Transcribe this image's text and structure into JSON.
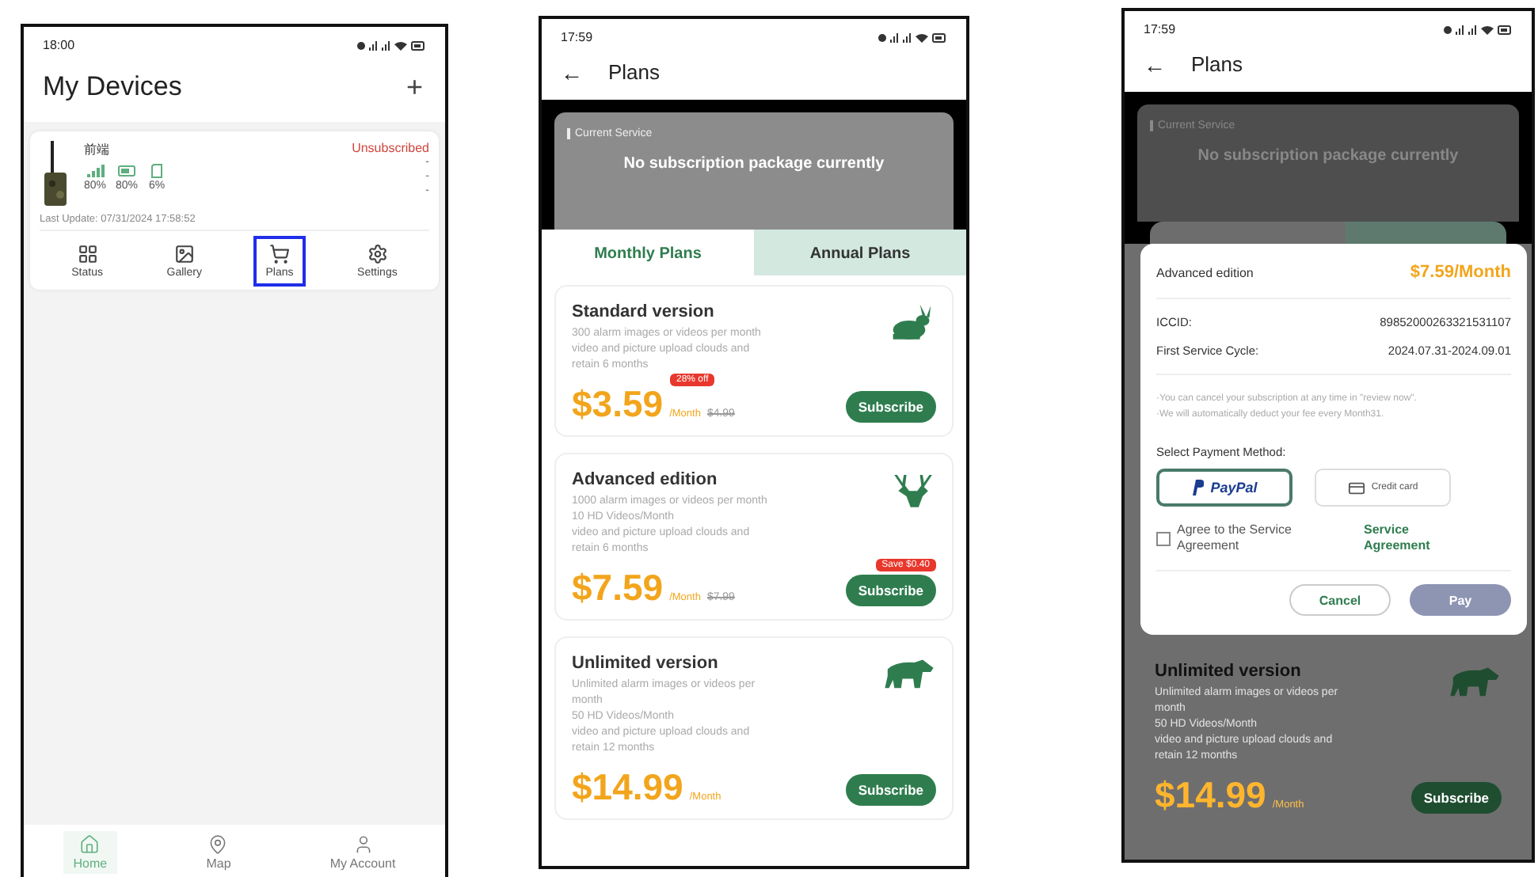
{
  "screens": [
    {
      "kind": "devices",
      "status_bar": {
        "time": "18:00"
      },
      "title": "My Devices",
      "add_button": "+",
      "device": {
        "name": "前端",
        "status": "Unsubscribed",
        "readings": [
          {
            "kind": "signal",
            "value": "80%"
          },
          {
            "kind": "battery",
            "value": "80%"
          },
          {
            "kind": "storage",
            "value": "6%"
          }
        ],
        "details": [
          "-",
          "-",
          "-"
        ],
        "last_update": "Last Update: 07/31/2024 17:58:52",
        "actions": [
          {
            "kind": "status",
            "label": "Status",
            "selected": false
          },
          {
            "kind": "gallery",
            "label": "Gallery",
            "selected": false
          },
          {
            "kind": "plans",
            "label": "Plans",
            "selected": true
          },
          {
            "kind": "settings",
            "label": "Settings",
            "selected": false
          }
        ]
      },
      "bottom_nav": [
        {
          "kind": "home",
          "label": "Home",
          "selected": true
        },
        {
          "kind": "map",
          "label": "Map",
          "selected": false
        },
        {
          "kind": "account",
          "label": "My Account",
          "selected": false
        }
      ]
    },
    {
      "kind": "plans",
      "status_bar": {
        "time": "17:59"
      },
      "header": {
        "back": "←",
        "title": "Plans"
      },
      "current_service": {
        "label": "Current Service",
        "text": "No subscription package currently"
      },
      "tabs": [
        {
          "label": "Monthly Plans",
          "selected": true
        },
        {
          "label": "Annual Plans",
          "selected": false
        }
      ],
      "plans": [
        {
          "kind": "standard",
          "name": "Standard version",
          "description": [
            "300 alarm images or videos per month",
            "video and picture upload clouds and retain 6 months"
          ],
          "price": "$3.59",
          "period": "/Month",
          "old_price": "$4.99",
          "badge": {
            "text": "28% off",
            "kind": "price"
          },
          "button": "Subscribe"
        },
        {
          "kind": "advanced",
          "name": "Advanced edition",
          "description": [
            "1000 alarm images or videos per month",
            "10 HD Videos/Month",
            "video and picture upload clouds and retain 6 months"
          ],
          "price": "$7.59",
          "period": "/Month",
          "old_price": "$7.99",
          "badge": {
            "text": "Save $0.40",
            "kind": "button"
          },
          "button": "Subscribe"
        },
        {
          "kind": "unlimited",
          "name": "Unlimited version",
          "description": [
            "Unlimited alarm images or videos per month",
            "50 HD Videos/Month",
            "video and picture upload clouds and retain 12 months"
          ],
          "price": "$14.99",
          "period": "/Month",
          "button": "Subscribe"
        }
      ]
    },
    {
      "kind": "checkout",
      "status_bar": {
        "time": "17:59"
      },
      "header": {
        "back": "←",
        "title": "Plans"
      },
      "current_service": {
        "label": "Current Service",
        "text": "No subscription package currently"
      },
      "dialog": {
        "plan": "Advanced edition",
        "price": "$7.59/Month",
        "fields": [
          {
            "label": "ICCID:",
            "value": "89852000263321531107"
          },
          {
            "label": "First Service Cycle:",
            "value": "2024.07.31-2024.09.01"
          }
        ],
        "notes": [
          "·You can cancel your subscription at any time in \"review now\".",
          "·We will automatically deduct your fee every Month31."
        ],
        "payment_label": "Select Payment Method:",
        "methods": [
          {
            "kind": "paypal",
            "label": "PayPal",
            "selected": true
          },
          {
            "kind": "card",
            "label": "Credit card",
            "selected": false
          }
        ],
        "agree": {
          "label": "Agree to the Service Agreement",
          "checked": false,
          "link": "Service Agreement"
        },
        "cancel": "Cancel",
        "pay": {
          "label": "Pay",
          "disabled": true
        }
      },
      "plans": [
        {
          "kind": "unlimited",
          "name": "Unlimited version",
          "description": [
            "Unlimited alarm images or videos per month",
            "50 HD Videos/Month",
            "video and picture upload clouds and retain 12 months"
          ],
          "price": "$14.99",
          "period": "/Month",
          "button": "Subscribe"
        }
      ]
    }
  ]
}
